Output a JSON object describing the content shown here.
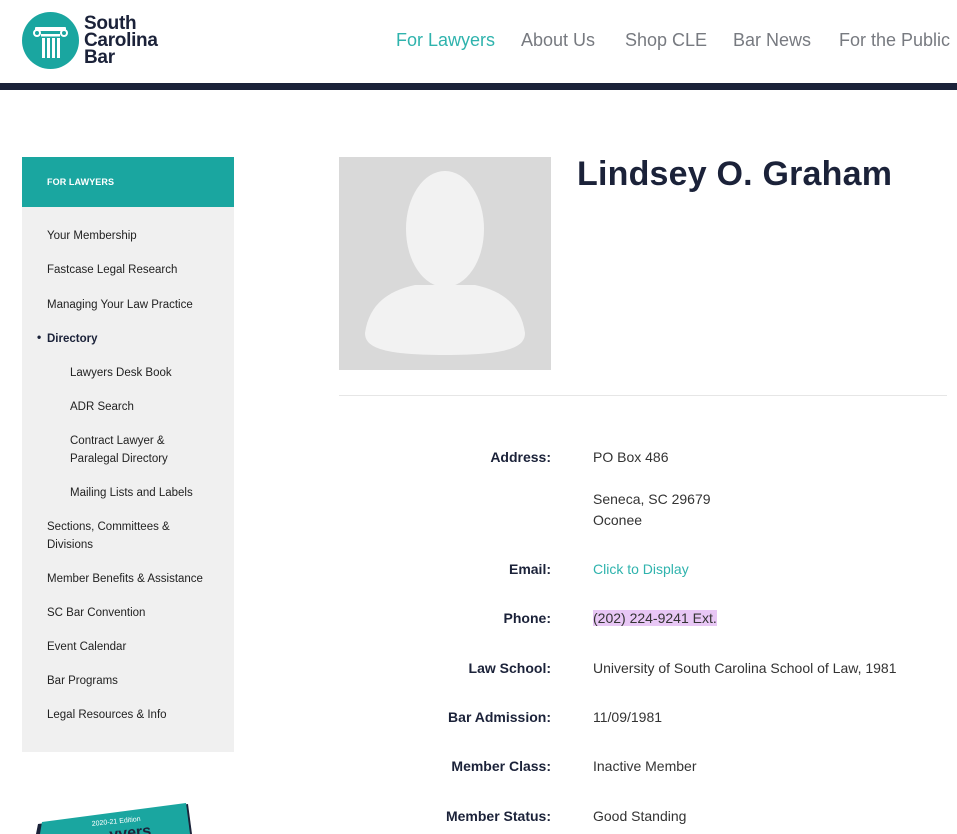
{
  "brand": {
    "line1": "South",
    "line2": "Carolina",
    "line3": "Bar",
    "accent": "#1aa6a0",
    "navy": "#1b2239",
    "icon": "column-icon"
  },
  "nav": {
    "items": [
      "For Lawyers",
      "About Us",
      "Shop CLE",
      "Bar News",
      "For the Public"
    ],
    "active": "For Lawyers"
  },
  "sidebar": {
    "heading": "FOR LAWYERS",
    "items": [
      "Your Membership",
      "Fastcase Legal Research",
      "Managing Your Law Practice",
      "Directory",
      "Lawyers Desk Book",
      "ADR Search",
      "Contract Lawyer & Paralegal Directory",
      "Mailing Lists and Labels",
      "Sections, Committees & Divisions",
      "Member Benefits & Assistance",
      "SC Bar Convention",
      "Event Calendar",
      "Bar Programs",
      "Legal Resources & Info"
    ],
    "current": "Directory"
  },
  "promo": {
    "edition": "2020-21 Edition",
    "title_fragment": "vvers"
  },
  "profile": {
    "name": "Lindsey O. Graham",
    "photo": "avatar-placeholder-icon",
    "fields": {
      "address_label": "Address:",
      "address_line1": "PO Box 486",
      "address_line2": "Seneca, SC 29679",
      "address_line3": "Oconee",
      "email_label": "Email:",
      "email_value": "Click to Display",
      "phone_label": "Phone:",
      "phone_value": "(202) 224-9241 Ext.",
      "school_label": "Law School:",
      "school_value": "University of South Carolina School of Law, 1981",
      "admission_label": "Bar Admission:",
      "admission_value": "11/09/1981",
      "class_label": "Member Class:",
      "class_value": "Inactive Member",
      "status_label": "Member Status:",
      "status_value": "Good Standing"
    }
  }
}
